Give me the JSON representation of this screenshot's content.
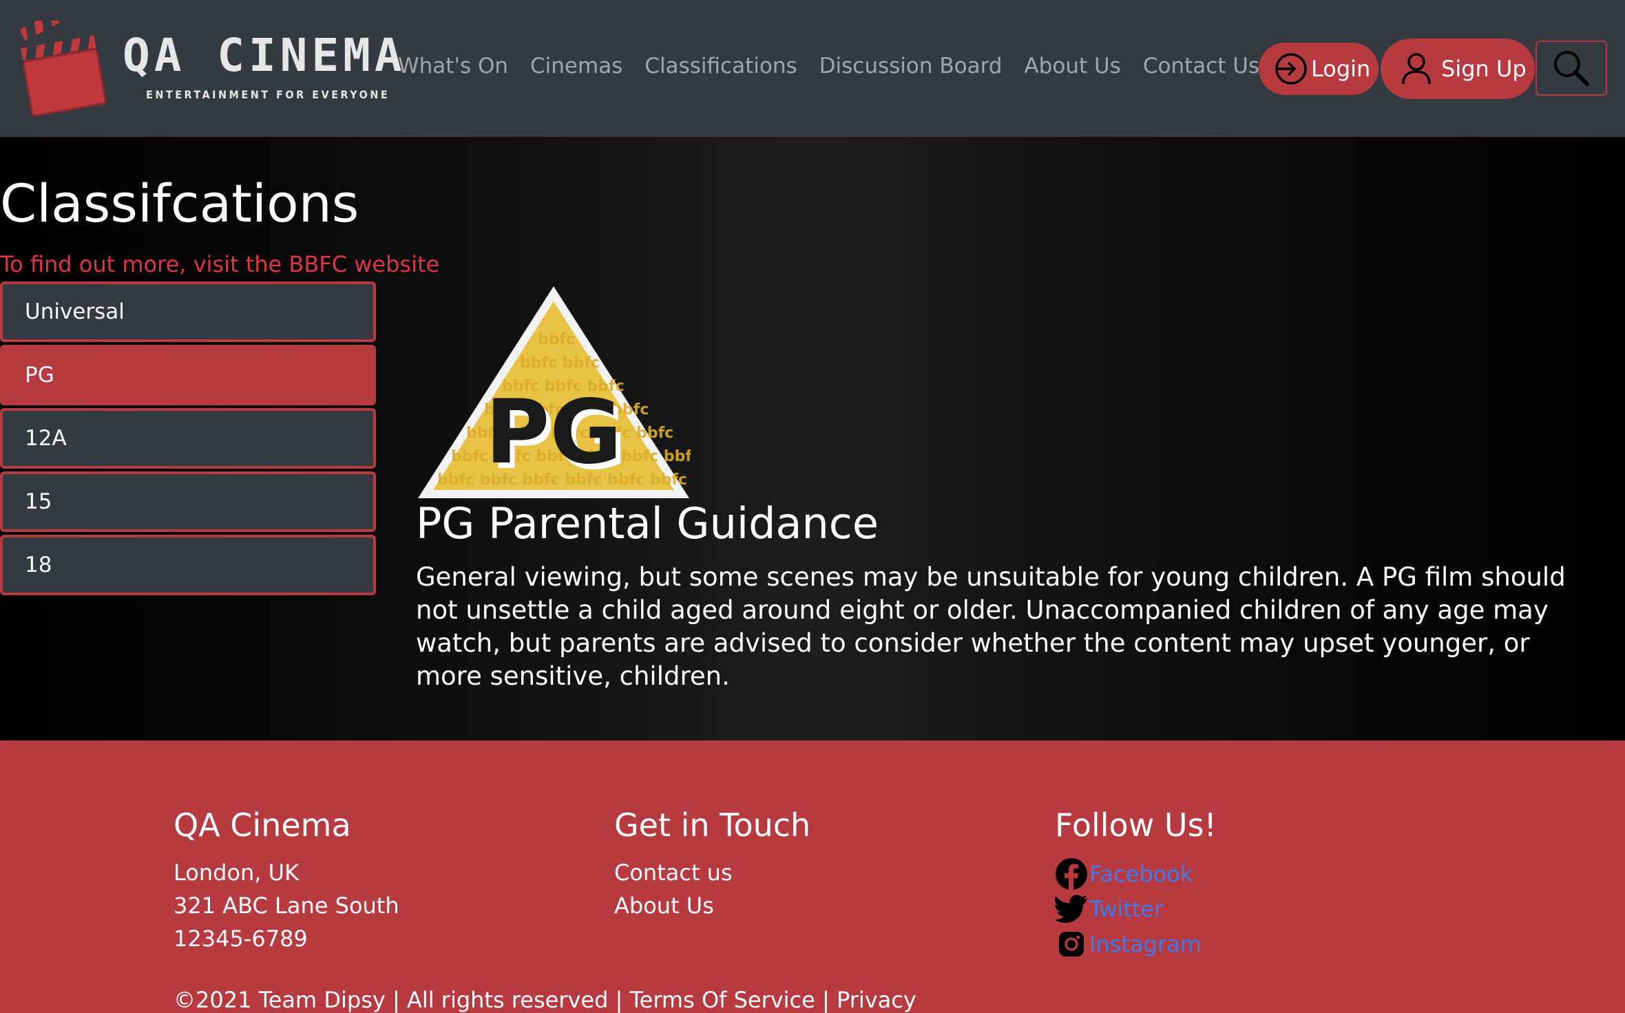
{
  "brand": {
    "name": "QA CINEMA",
    "tagline": "ENTERTAINMENT FOR EVERYONE",
    "icon": "clapperboard-icon"
  },
  "nav": {
    "links": [
      "What's On",
      "Cinemas",
      "Classifications",
      "Discussion Board",
      "About Us",
      "Contact Us"
    ],
    "login_label": "Login",
    "signup_label": "Sign Up",
    "search_icon": "search-icon"
  },
  "main": {
    "title": "Classifcations",
    "bbfc_link": "To find out more, visit the BBFC website",
    "classifications": [
      "Universal",
      "PG",
      "12A",
      "15",
      "18"
    ],
    "selected": "PG",
    "detail": {
      "badge_text": "PG",
      "title": "PG Parental Guidance",
      "description": "General viewing, but some scenes may be unsuitable for young children. A PG film should not unsettle a child aged around eight or older. Unaccompanied children of any age may watch, but parents are advised to consider whether the content may upset younger, or more sensitive, children."
    }
  },
  "footer": {
    "col1": {
      "heading": "QA Cinema",
      "lines": [
        "London, UK",
        "321 ABC Lane South",
        "12345-6789"
      ]
    },
    "col2": {
      "heading": "Get in Touch",
      "links": [
        "Contact us",
        "About Us"
      ]
    },
    "col3": {
      "heading": "Follow Us!",
      "social": [
        {
          "label": "Facebook",
          "icon": "facebook-icon"
        },
        {
          "label": "Twitter",
          "icon": "twitter-icon"
        },
        {
          "label": "Instagram",
          "icon": "instagram-icon"
        }
      ]
    },
    "copyright": "©2021 Team Dipsy | All rights reserved | Terms Of Service | Privacy"
  },
  "colors": {
    "navbar": "#343a40",
    "accent": "#b83a41",
    "link_red": "#dc3545",
    "social_link": "#3d7bf0",
    "badge_yellow": "#e8c245"
  }
}
